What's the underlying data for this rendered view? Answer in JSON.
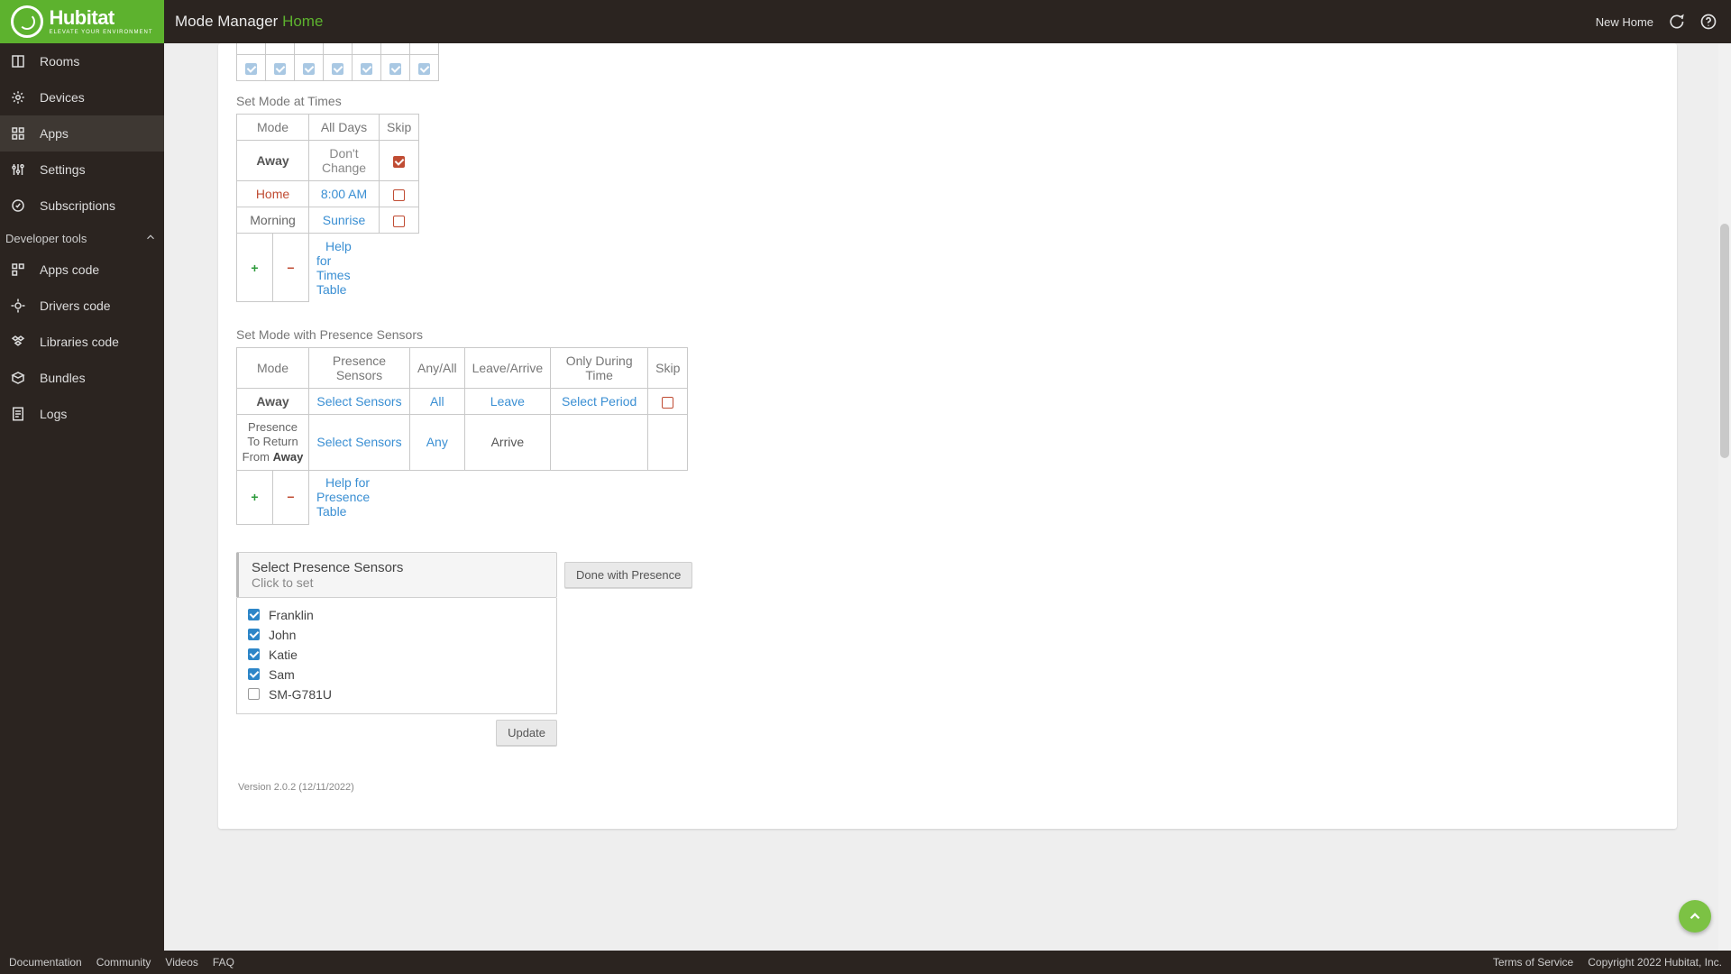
{
  "header": {
    "title_prefix": "Mode Manager ",
    "title_accent": "Home",
    "right_label": "New Home"
  },
  "logo": {
    "name": "Hubitat",
    "tagline": "ELEVATE YOUR ENVIRONMENT"
  },
  "sidebar": {
    "items": [
      {
        "label": "Rooms",
        "active": false
      },
      {
        "label": "Devices",
        "active": false
      },
      {
        "label": "Apps",
        "active": true
      },
      {
        "label": "Settings",
        "active": false
      },
      {
        "label": "Subscriptions",
        "active": false
      }
    ],
    "section": "Developer tools",
    "dev_items": [
      {
        "label": "Apps code"
      },
      {
        "label": "Drivers code"
      },
      {
        "label": "Libraries code"
      },
      {
        "label": "Bundles"
      },
      {
        "label": "Logs"
      }
    ]
  },
  "times": {
    "section_label": "Set Mode at Times",
    "headers": {
      "mode": "Mode",
      "alldays": "All Days",
      "skip": "Skip"
    },
    "rows": [
      {
        "mode": "Away",
        "mode_link": false,
        "all_days": "Don't Change",
        "all_days_link": false,
        "skip": true
      },
      {
        "mode": "Home",
        "mode_link": true,
        "all_days": "8:00 AM",
        "all_days_link": true,
        "skip": false
      },
      {
        "mode": "Morning",
        "mode_link": false,
        "all_days": "Sunrise",
        "all_days_link": true,
        "skip": false
      }
    ],
    "help": "Help for Times Table"
  },
  "day_header_row": {
    "checks": [
      true,
      true,
      true,
      true,
      true,
      true,
      true
    ]
  },
  "presence": {
    "section_label": "Set Mode with Presence Sensors",
    "headers": {
      "mode": "Mode",
      "sensors": "Presence Sensors",
      "anyall": "Any/All",
      "leavearrive": "Leave/Arrive",
      "period": "Only During Time",
      "skip": "Skip"
    },
    "rows": [
      {
        "mode_html": "Away",
        "mode_bold_suffix": "",
        "sensors": "Select Sensors",
        "anyall": "All",
        "leavearrive": "Leave",
        "leavearrive_link": true,
        "period": "Select Period",
        "skip_shown": true
      },
      {
        "mode_pref": "Presence To Return From ",
        "mode_bold_suffix": "Away",
        "sensors": "Select Sensors",
        "anyall": "Any",
        "leavearrive": "Arrive",
        "leavearrive_link": false,
        "period": "",
        "skip_shown": false
      }
    ],
    "help": "Help for Presence Table"
  },
  "select_panel": {
    "title": "Select Presence Sensors",
    "subtitle": "Click to set",
    "done_label": "Done with Presence",
    "items": [
      {
        "label": "Franklin",
        "checked": true
      },
      {
        "label": "John",
        "checked": true
      },
      {
        "label": "Katie",
        "checked": true
      },
      {
        "label": "Sam",
        "checked": true
      },
      {
        "label": "SM-G781U",
        "checked": false
      }
    ],
    "update_label": "Update"
  },
  "version": "Version 2.0.2 (12/11/2022)",
  "footer": {
    "left": [
      "Documentation",
      "Community",
      "Videos",
      "FAQ"
    ],
    "right": [
      "Terms of Service",
      "Copyright 2022 Hubitat, Inc."
    ]
  }
}
